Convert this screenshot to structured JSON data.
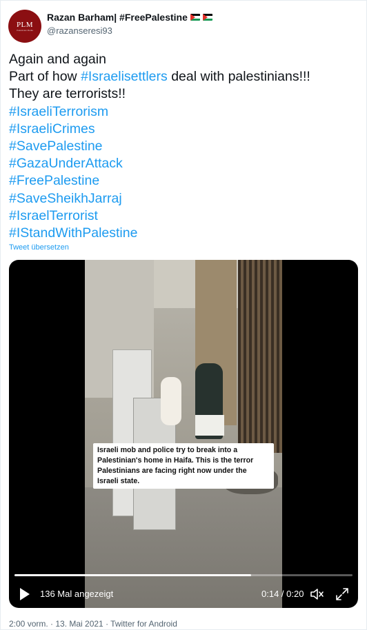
{
  "author": {
    "avatar_text": "PLM",
    "avatar_subtext": "Palestinian Media",
    "display_name": "Razan Barham| #FreePalestine",
    "handle": "@razanseresi93"
  },
  "tweet": {
    "lines": [
      {
        "text": "Again and again"
      },
      {
        "pre": "Part of how ",
        "tag": "#Israelisettlers",
        "post": "  deal with palestinians!!!"
      },
      {
        "text": "They are terrorists!!"
      }
    ],
    "hashtags": [
      "#IsraeliTerrorism",
      "#IsraeliCrimes",
      "#SavePalestine",
      "#GazaUnderAttack",
      "#FreePalestine",
      "#SaveSheikhJarraj",
      "#IsraelTerrorist",
      "#IStandWithPalestine"
    ],
    "translate_label": "Tweet übersetzen"
  },
  "video": {
    "caption_lines": [
      "Israeli mob and police try to break into a",
      "Palestinian's home in Haifa. This is the terror",
      "Palestinians are facing right now under the",
      "Israeli state."
    ],
    "views_label": "136 Mal angezeigt",
    "time_label": "0:14 / 0:20",
    "progress_fraction": 0.7,
    "icons": [
      "play-icon",
      "volume-icon",
      "expand-icon"
    ]
  },
  "footer": {
    "meta": "2:00 vorm. · 13. Mai 2021 · Twitter for Android"
  },
  "colors": {
    "link": "#1d9bf0",
    "avatar_bg": "#8b0f12",
    "secondary_text": "#536471"
  }
}
